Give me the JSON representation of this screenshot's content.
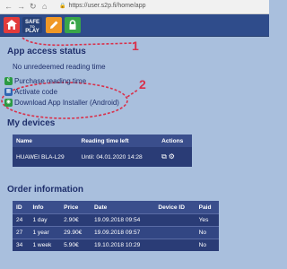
{
  "browser": {
    "url": "https://user.s2p.fi/home/app"
  },
  "toolbar": {
    "safe_line1": "SAFE",
    "safe_line2": "TO",
    "safe_line3": "PLAY"
  },
  "access": {
    "title": "App access status",
    "status": "No unredeemed reading time",
    "links": [
      {
        "label": "Purchase reading time",
        "icon": "euro-icon"
      },
      {
        "label": "Activate code",
        "icon": "code-icon"
      },
      {
        "label": "Download App Installer (Android)",
        "icon": "android-icon"
      }
    ]
  },
  "annotations": {
    "one": "1",
    "two": "2"
  },
  "devices": {
    "title": "My devices",
    "headers": [
      "Name",
      "Reading time left",
      "Actions"
    ],
    "rows": [
      {
        "name": "HUAWEI BLA-L29",
        "time_left": "Until: 04.01.2020 14:28"
      }
    ]
  },
  "orders": {
    "title": "Order information",
    "headers": [
      "ID",
      "Info",
      "Price",
      "Date",
      "Device ID",
      "Paid"
    ],
    "rows": [
      {
        "id": "24",
        "info": "1 day",
        "price": "2.90€",
        "date": "19.09.2018 09:54",
        "device": "",
        "paid": "Yes"
      },
      {
        "id": "27",
        "info": "1 year",
        "price": "29.90€",
        "date": "19.09.2018 09:57",
        "device": "",
        "paid": "No"
      },
      {
        "id": "34",
        "info": "1 week",
        "price": "5.90€",
        "date": "19.10.2018 10:29",
        "device": "",
        "paid": "No"
      }
    ]
  },
  "colors": {
    "background": "#a9bfdd",
    "toolbar": "#2f4c8b",
    "table_dark": "#2a3c76",
    "annotation": "#d9304a"
  }
}
